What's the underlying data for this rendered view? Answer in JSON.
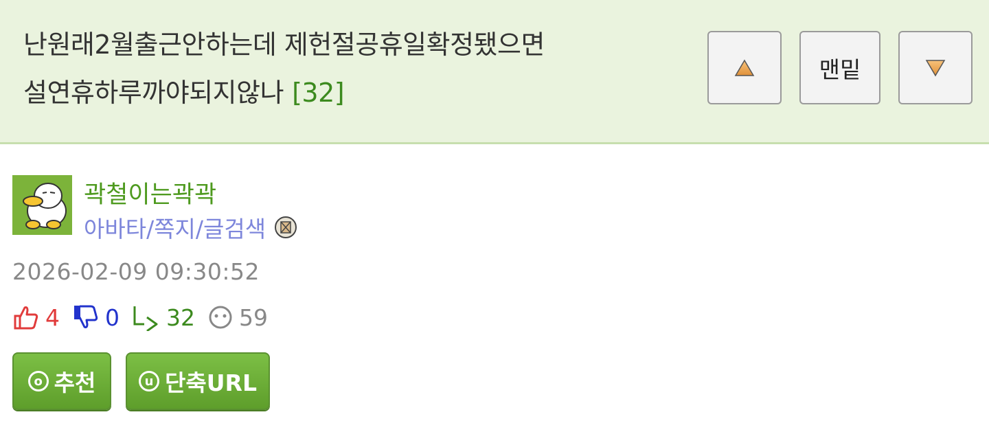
{
  "post": {
    "title_line1": "난원래2월출근안하는데 제헌절공휴일확정됐으면",
    "title_line2": "설연휴하루까야되지않나",
    "comment_count": "[32]"
  },
  "nav": {
    "up_icon": "triangle-up-icon",
    "bottom_label": "맨밑",
    "down_icon": "triangle-down-icon"
  },
  "author": {
    "nickname": "곽철이는곽곽",
    "links": "아바타/쪽지/글검색",
    "avatar_icon": "duck-avatar",
    "badge_icon": "level-badge-icon"
  },
  "date": "2026-02-09 09:30:52",
  "stats": {
    "likes": "4",
    "dislikes": "0",
    "replies": "32",
    "views": "59"
  },
  "actions": {
    "recommend_label": "추천",
    "recommend_icon_char": "o",
    "shorturl_label": "단축URL",
    "shorturl_icon_char": "u"
  },
  "colors": {
    "header_bg": "#eaf3de",
    "accent_green": "#4e9a1f",
    "link_purple": "#7d86db",
    "like_red": "#e13b3b",
    "dislike_blue": "#2233cc"
  }
}
